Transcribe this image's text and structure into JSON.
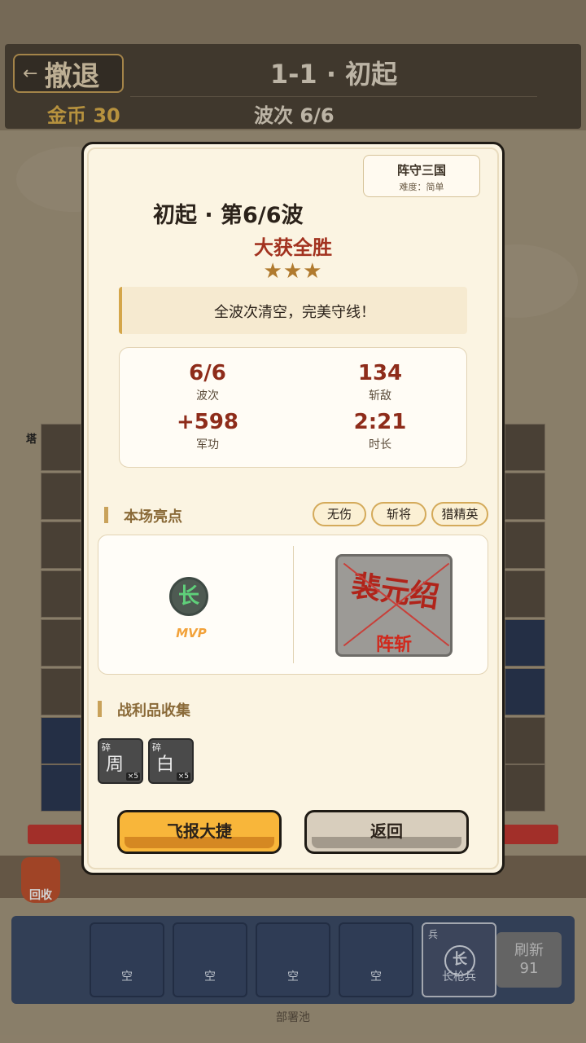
{
  "header": {
    "retreat_label": "撤退",
    "level_title": "1-1 · 初起",
    "gold_label": "金币",
    "gold_value": "30",
    "wave_label": "波次",
    "wave_value": "6/6"
  },
  "board": {
    "tower_tag": "塔",
    "recycle_label": "回收"
  },
  "pool": {
    "slots": [
      "空",
      "空",
      "空",
      "空"
    ],
    "unit_badge": "兵",
    "unit_char": "长",
    "unit_name": "长枪兵",
    "refresh_label": "刷新",
    "refresh_cost": "91",
    "label": "部署池"
  },
  "result": {
    "brand_name": "阵守三国",
    "difficulty": "难度：简单",
    "stage": "初起 · 第6/6波",
    "outcome": "大获全胜",
    "stars": "★★★",
    "quote": "全波次清空，完美守线！",
    "stats": [
      {
        "value": "6/6",
        "label": "波次"
      },
      {
        "value": "134",
        "label": "斩敌"
      },
      {
        "value": "+598",
        "label": "军功"
      },
      {
        "value": "2:21",
        "label": "时长"
      }
    ],
    "highlights_title": "本场亮点",
    "tags": [
      "无伤",
      "斩将",
      "猎精英"
    ],
    "mvp_char": "长",
    "mvp_label": "MVP",
    "killed_general": "裴元绍",
    "killed_label": "阵斩",
    "loot_title": "战利品收集",
    "loot": [
      {
        "frag": "碎",
        "char": "周",
        "count": "×5"
      },
      {
        "frag": "碎",
        "char": "白",
        "count": "×5"
      }
    ],
    "share_button": "飞报大捷",
    "back_button": "返回"
  },
  "colors": {
    "accent_gold": "#f8b63a",
    "victory_red": "#a2321f",
    "modal_bg": "#fbf4e2"
  }
}
